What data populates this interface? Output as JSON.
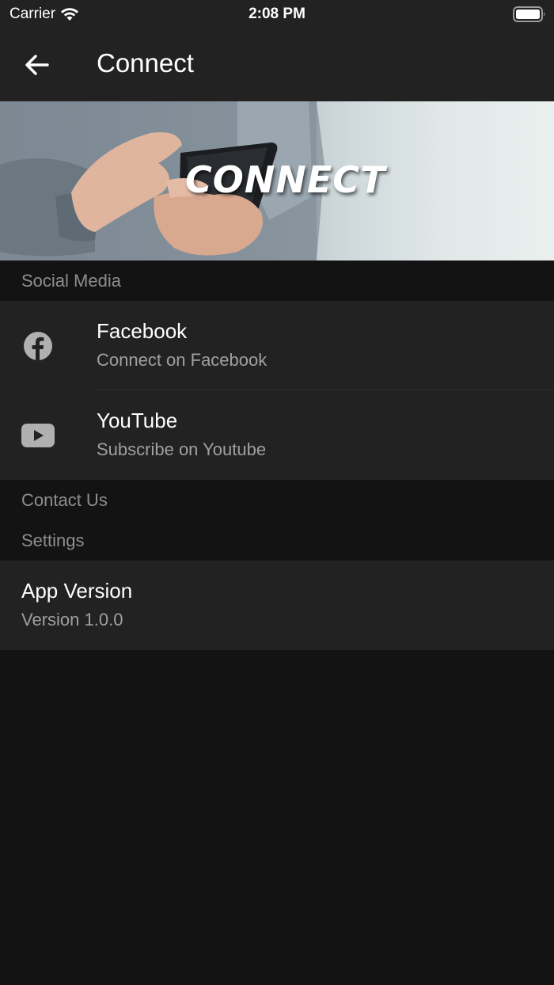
{
  "status_bar": {
    "carrier": "Carrier",
    "time": "2:08 PM"
  },
  "nav": {
    "title": "Connect",
    "back_icon": "arrow-left-icon"
  },
  "hero": {
    "word": "CONNECT"
  },
  "sections": {
    "social_media": "Social Media",
    "contact_us": "Contact Us",
    "settings": "Settings"
  },
  "social_items": [
    {
      "title": "Facebook",
      "subtitle": "Connect on Facebook",
      "icon": "facebook-icon"
    },
    {
      "title": "YouTube",
      "subtitle": "Subscribe on Youtube",
      "icon": "youtube-icon"
    }
  ],
  "app_version": {
    "title": "App Version",
    "value": "Version 1.0.0"
  },
  "colors": {
    "background": "#131313",
    "surface": "#222222",
    "section_text": "#8e8e8e",
    "subtitle_text": "#a0a0a0",
    "icon": "#b0b0b0"
  }
}
